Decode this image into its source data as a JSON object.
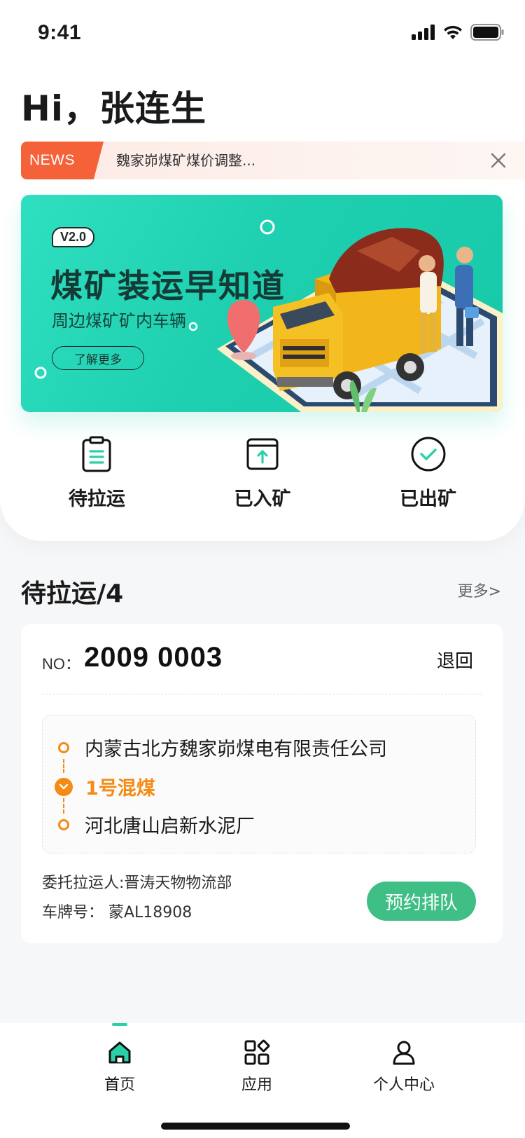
{
  "status_bar": {
    "time": "9:41"
  },
  "greeting": "Hi，张连生",
  "news": {
    "tag": "NEWS",
    "text": "魏家峁煤矿煤价调整..."
  },
  "banner": {
    "version": "V2.0",
    "title": "煤矿装运早知道",
    "subtitle": "周边煤矿矿内车辆",
    "button": "了解更多"
  },
  "quick_actions": [
    {
      "label": "待拉运",
      "icon": "clipboard-icon"
    },
    {
      "label": "已入矿",
      "icon": "box-arrow-up-icon"
    },
    {
      "label": "已出矿",
      "icon": "check-circle-icon"
    }
  ],
  "section": {
    "title": "待拉运/4",
    "more": "更多>"
  },
  "order": {
    "no_label": "NO：",
    "no": "2009 0003",
    "return_label": "退回",
    "origin": "内蒙古北方魏家峁煤电有限责任公司",
    "coal_type": "1号混煤",
    "destination": "河北唐山启新水泥厂",
    "carrier": "委托拉运人:晋涛天物物流部",
    "plate": "车牌号：  蒙AL18908",
    "queue_button": "预约排队"
  },
  "bottom_nav": [
    {
      "label": "首页",
      "icon": "home-icon",
      "active": true
    },
    {
      "label": "应用",
      "icon": "apps-icon",
      "active": false
    },
    {
      "label": "个人中心",
      "icon": "person-icon",
      "active": false
    }
  ],
  "colors": {
    "accent": "#2bd0a8",
    "orange": "#f58a14",
    "news_tag": "#f5623a",
    "queue_button": "#3fbf86"
  }
}
